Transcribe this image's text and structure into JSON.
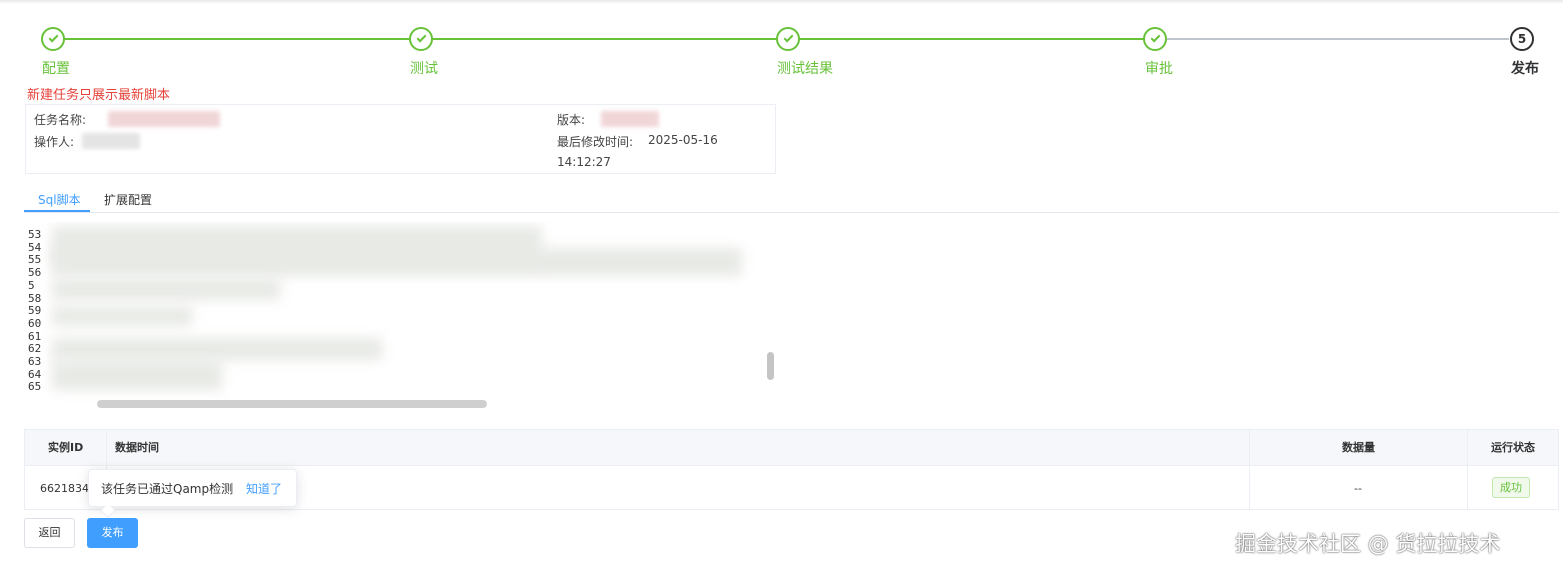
{
  "steps": [
    {
      "title": "配置",
      "state": "done"
    },
    {
      "title": "测试",
      "state": "done"
    },
    {
      "title": "测试结果",
      "state": "done"
    },
    {
      "title": "审批",
      "state": "done"
    },
    {
      "title": "发布",
      "state": "current",
      "number": "5"
    }
  ],
  "notice": "新建任务只展示最新脚本",
  "info": {
    "task_name_label": "任务名称:",
    "version_label": "版本:",
    "operator_label": "操作人:",
    "modified_label": "最后修改时间:",
    "modified_date": "2025-05-16",
    "modified_time": "14:12:27"
  },
  "tabs": [
    {
      "label": "Sql脚本",
      "active": true
    },
    {
      "label": "扩展配置",
      "active": false
    }
  ],
  "editor": {
    "line_numbers": [
      "53",
      "54",
      "55",
      "56",
      "5",
      "58",
      "59",
      "60",
      "61",
      "62",
      "63",
      "64",
      "65"
    ]
  },
  "table": {
    "headers": {
      "instance_id": "实例ID",
      "data_time": "数据时间",
      "data_count": "数据量",
      "run_status": "运行状态"
    },
    "rows": [
      {
        "instance_id": "66218340",
        "data_count": "--",
        "run_status": "成功"
      }
    ]
  },
  "popover": {
    "text": "该任务已通过Qamp检测",
    "link": "知道了"
  },
  "buttons": {
    "back": "返回",
    "publish": "发布"
  },
  "watermark": "掘金技术社区 @ 货拉拉技术",
  "colors": {
    "success": "#67c23a",
    "primary": "#409eff",
    "danger": "#e6423a"
  }
}
